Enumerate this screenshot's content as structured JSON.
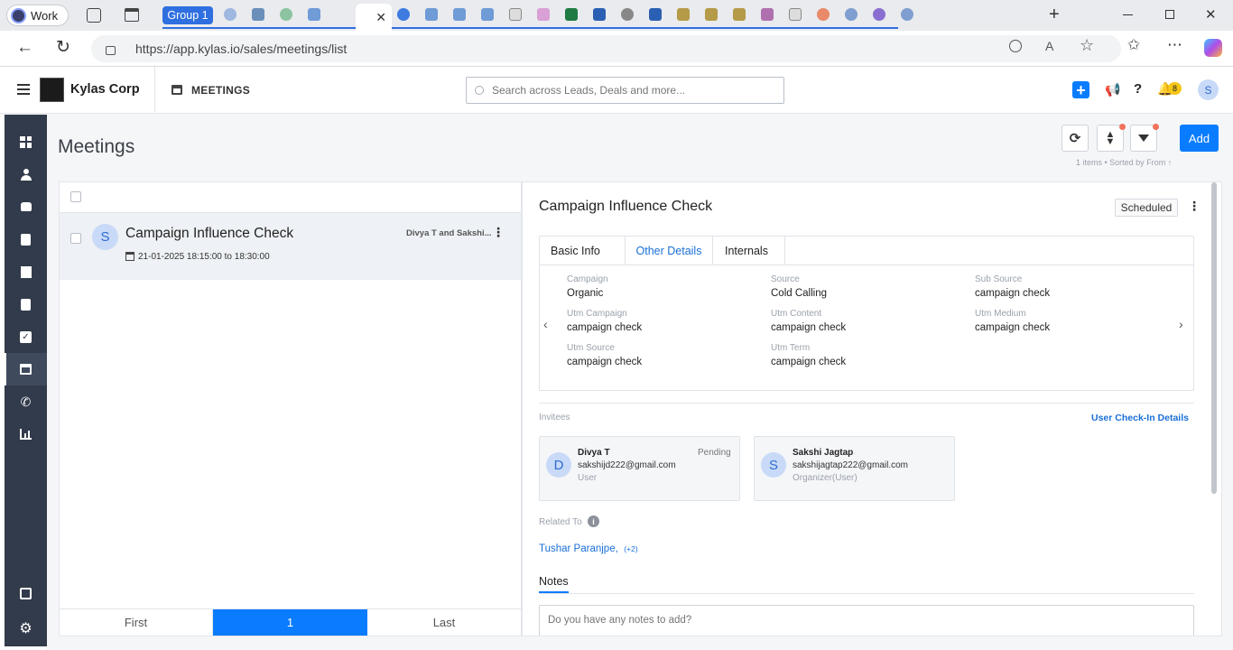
{
  "browser": {
    "profile": "Work",
    "tab_group": "Group 1",
    "url": "https://app.kylas.io/sales/meetings/list"
  },
  "app": {
    "company": "Kylas Corp",
    "module": "MEETINGS",
    "search_placeholder": "Search across Leads, Deals and more...",
    "notification_count": "8",
    "user_initial": "S"
  },
  "page": {
    "title": "Meetings",
    "add_label": "Add",
    "sort_info": "1 items • Sorted by",
    "sort_field": "From ↑"
  },
  "list": {
    "items": [
      {
        "initial": "S",
        "title": "Campaign Influence Check",
        "participants": "Divya T and Sakshi...",
        "time": "21-01-2025 18:15:00 to 18:30:00"
      }
    ],
    "pagination": {
      "first": "First",
      "current": "1",
      "last": "Last"
    }
  },
  "detail": {
    "title": "Campaign Influence Check",
    "status": "Scheduled",
    "tabs": [
      "Basic Info",
      "Other Details",
      "Internals"
    ],
    "active_tab": "Other Details",
    "fields": [
      {
        "label": "Campaign",
        "value": "Organic"
      },
      {
        "label": "Source",
        "value": "Cold Calling"
      },
      {
        "label": "Sub Source",
        "value": "campaign check"
      },
      {
        "label": "Utm Campaign",
        "value": "campaign check"
      },
      {
        "label": "Utm Content",
        "value": "campaign check"
      },
      {
        "label": "Utm Medium",
        "value": "campaign check"
      },
      {
        "label": "Utm Source",
        "value": "campaign check"
      },
      {
        "label": "Utm Term",
        "value": "campaign check"
      }
    ],
    "invitees_label": "Invitees",
    "checkin_link": "User Check-In Details",
    "invitees": [
      {
        "initial": "D",
        "name": "Divya T",
        "email": "sakshijd222@gmail.com",
        "role": "User",
        "status": "Pending"
      },
      {
        "initial": "S",
        "name": "Sakshi Jagtap",
        "email": "sakshijagtap222@gmail.com",
        "role": "Organizer(User)",
        "status": ""
      }
    ],
    "related_label": "Related To",
    "related_name": "Tushar Paranjpe,",
    "related_more": "(+2)",
    "notes_label": "Notes",
    "notes_placeholder": "Do you have any notes to add?"
  },
  "colors": {
    "accent": "#0a7cff",
    "nav_bg": "#323b4b",
    "selected_row": "#eef1f5"
  }
}
